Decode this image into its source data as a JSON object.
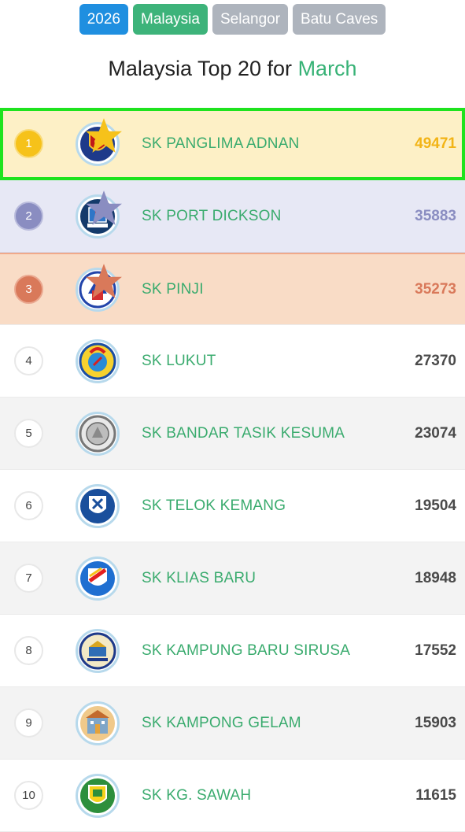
{
  "filters": {
    "year": "2026",
    "country": "Malaysia",
    "state": "Selangor",
    "city": "Batu Caves"
  },
  "heading": {
    "prefix": "Malaysia Top 20 for ",
    "month": "March"
  },
  "colors": {
    "accent_green": "#37b276",
    "year_chip": "#1f8fe0",
    "gold": "#f6c21a",
    "silver": "#8a8dc1",
    "bronze": "#d9795a",
    "highlight_outline": "#1ee31e"
  },
  "leaderboard": [
    {
      "rank": "1",
      "name": "SK PANGLIMA ADNAN",
      "score": "49471",
      "logo_icon": "school-crest-icon"
    },
    {
      "rank": "2",
      "name": "SK PORT DICKSON",
      "score": "35883",
      "logo_icon": "school-crest-icon"
    },
    {
      "rank": "3",
      "name": "SK PINJI",
      "score": "35273",
      "logo_icon": "school-crest-icon"
    },
    {
      "rank": "4",
      "name": "SK LUKUT",
      "score": "27370",
      "logo_icon": "school-crest-icon"
    },
    {
      "rank": "5",
      "name": "SK BANDAR TASIK KESUMA",
      "score": "23074",
      "logo_icon": "school-crest-icon"
    },
    {
      "rank": "6",
      "name": "SK TELOK KEMANG",
      "score": "19504",
      "logo_icon": "school-crest-icon"
    },
    {
      "rank": "7",
      "name": "SK KLIAS BARU",
      "score": "18948",
      "logo_icon": "school-crest-icon"
    },
    {
      "rank": "8",
      "name": "SK KAMPUNG BARU SIRUSA",
      "score": "17552",
      "logo_icon": "school-crest-icon"
    },
    {
      "rank": "9",
      "name": "SK KAMPONG GELAM",
      "score": "15903",
      "logo_icon": "school-crest-icon"
    },
    {
      "rank": "10",
      "name": "SK KG. SAWAH",
      "score": "11615",
      "logo_icon": "school-crest-icon"
    }
  ]
}
